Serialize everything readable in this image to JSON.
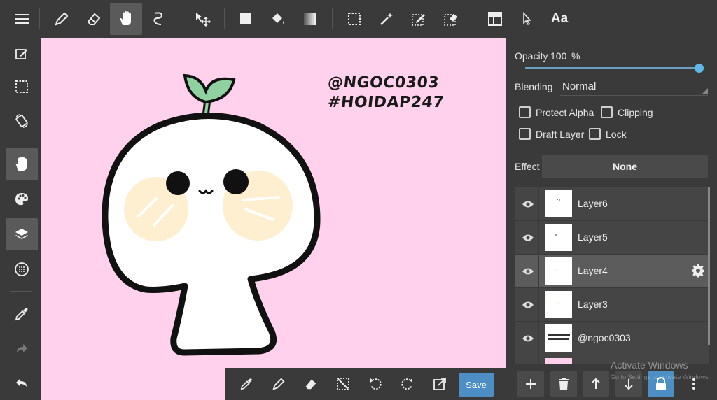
{
  "toolbar": {
    "tools": [
      "pen-tool",
      "eraser-tool",
      "hand-tool",
      "lasso-tool",
      "move-tool",
      "fill-rect-tool",
      "bucket-tool",
      "gradient-tool",
      "select-rect-tool",
      "magic-wand-tool",
      "select-pen-tool",
      "select-eraser-tool",
      "layout-tool",
      "pointer-tool",
      "text-tool"
    ],
    "text_tool_label": "Aa",
    "active_tool": "hand-tool"
  },
  "left_toolbar": {
    "buttons": [
      "menu-icon",
      "edit-icon",
      "selection-icon",
      "rotate-icon",
      "hand-icon",
      "palette-icon",
      "layers-icon",
      "grid-icon",
      "eyedropper-icon",
      "redo-icon",
      "undo-icon"
    ]
  },
  "canvas": {
    "background": "#ffd1ec",
    "caption_line1": "@NGOC0303",
    "caption_line2": "#HOIDAP247"
  },
  "panel": {
    "opacity_label": "Opacity",
    "opacity_value": "100",
    "opacity_unit": "%",
    "opacity_fraction": 1.0,
    "blending_label": "Blending",
    "blending_value": "Normal",
    "protect_alpha_label": "Protect Alpha",
    "clipping_label": "Clipping",
    "draft_layer_label": "Draft Layer",
    "lock_label": "Lock",
    "effect_label": "Effect",
    "effect_value": "None",
    "layers": [
      {
        "name": "Layer6",
        "selected": false
      },
      {
        "name": "Layer5",
        "selected": false
      },
      {
        "name": "Layer4",
        "selected": true
      },
      {
        "name": "Layer3",
        "selected": false
      },
      {
        "name": "@ngoc0303",
        "selected": false
      }
    ],
    "accent": "#4d8fc4"
  },
  "bottombar": {
    "save_label": "Save"
  },
  "watermark": {
    "line1": "Activate Windows",
    "line2": "Go to Settings to activate Windows."
  }
}
